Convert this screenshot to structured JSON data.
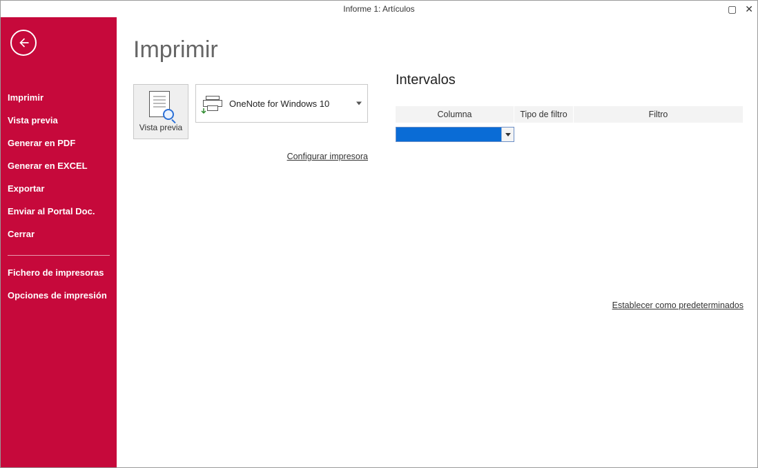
{
  "window": {
    "title": "Informe 1: Artículos"
  },
  "sidebar": {
    "items": [
      "Imprimir",
      "Vista previa",
      "Generar en PDF",
      "Generar en EXCEL",
      "Exportar",
      "Enviar al Portal Doc.",
      "Cerrar"
    ],
    "items2": [
      "Fichero de impresoras",
      "Opciones de impresión"
    ]
  },
  "main": {
    "page_title": "Imprimir",
    "preview_label": "Vista previa",
    "printer_selected": "OneNote for Windows 10",
    "configure_printer": "Configurar impresora"
  },
  "intervals": {
    "title": "Intervalos",
    "headers": {
      "col1": "Columna",
      "col2": "Tipo de filtro",
      "col3": "Filtro"
    },
    "selected_column": "",
    "set_default": "Establecer como predeterminados"
  }
}
